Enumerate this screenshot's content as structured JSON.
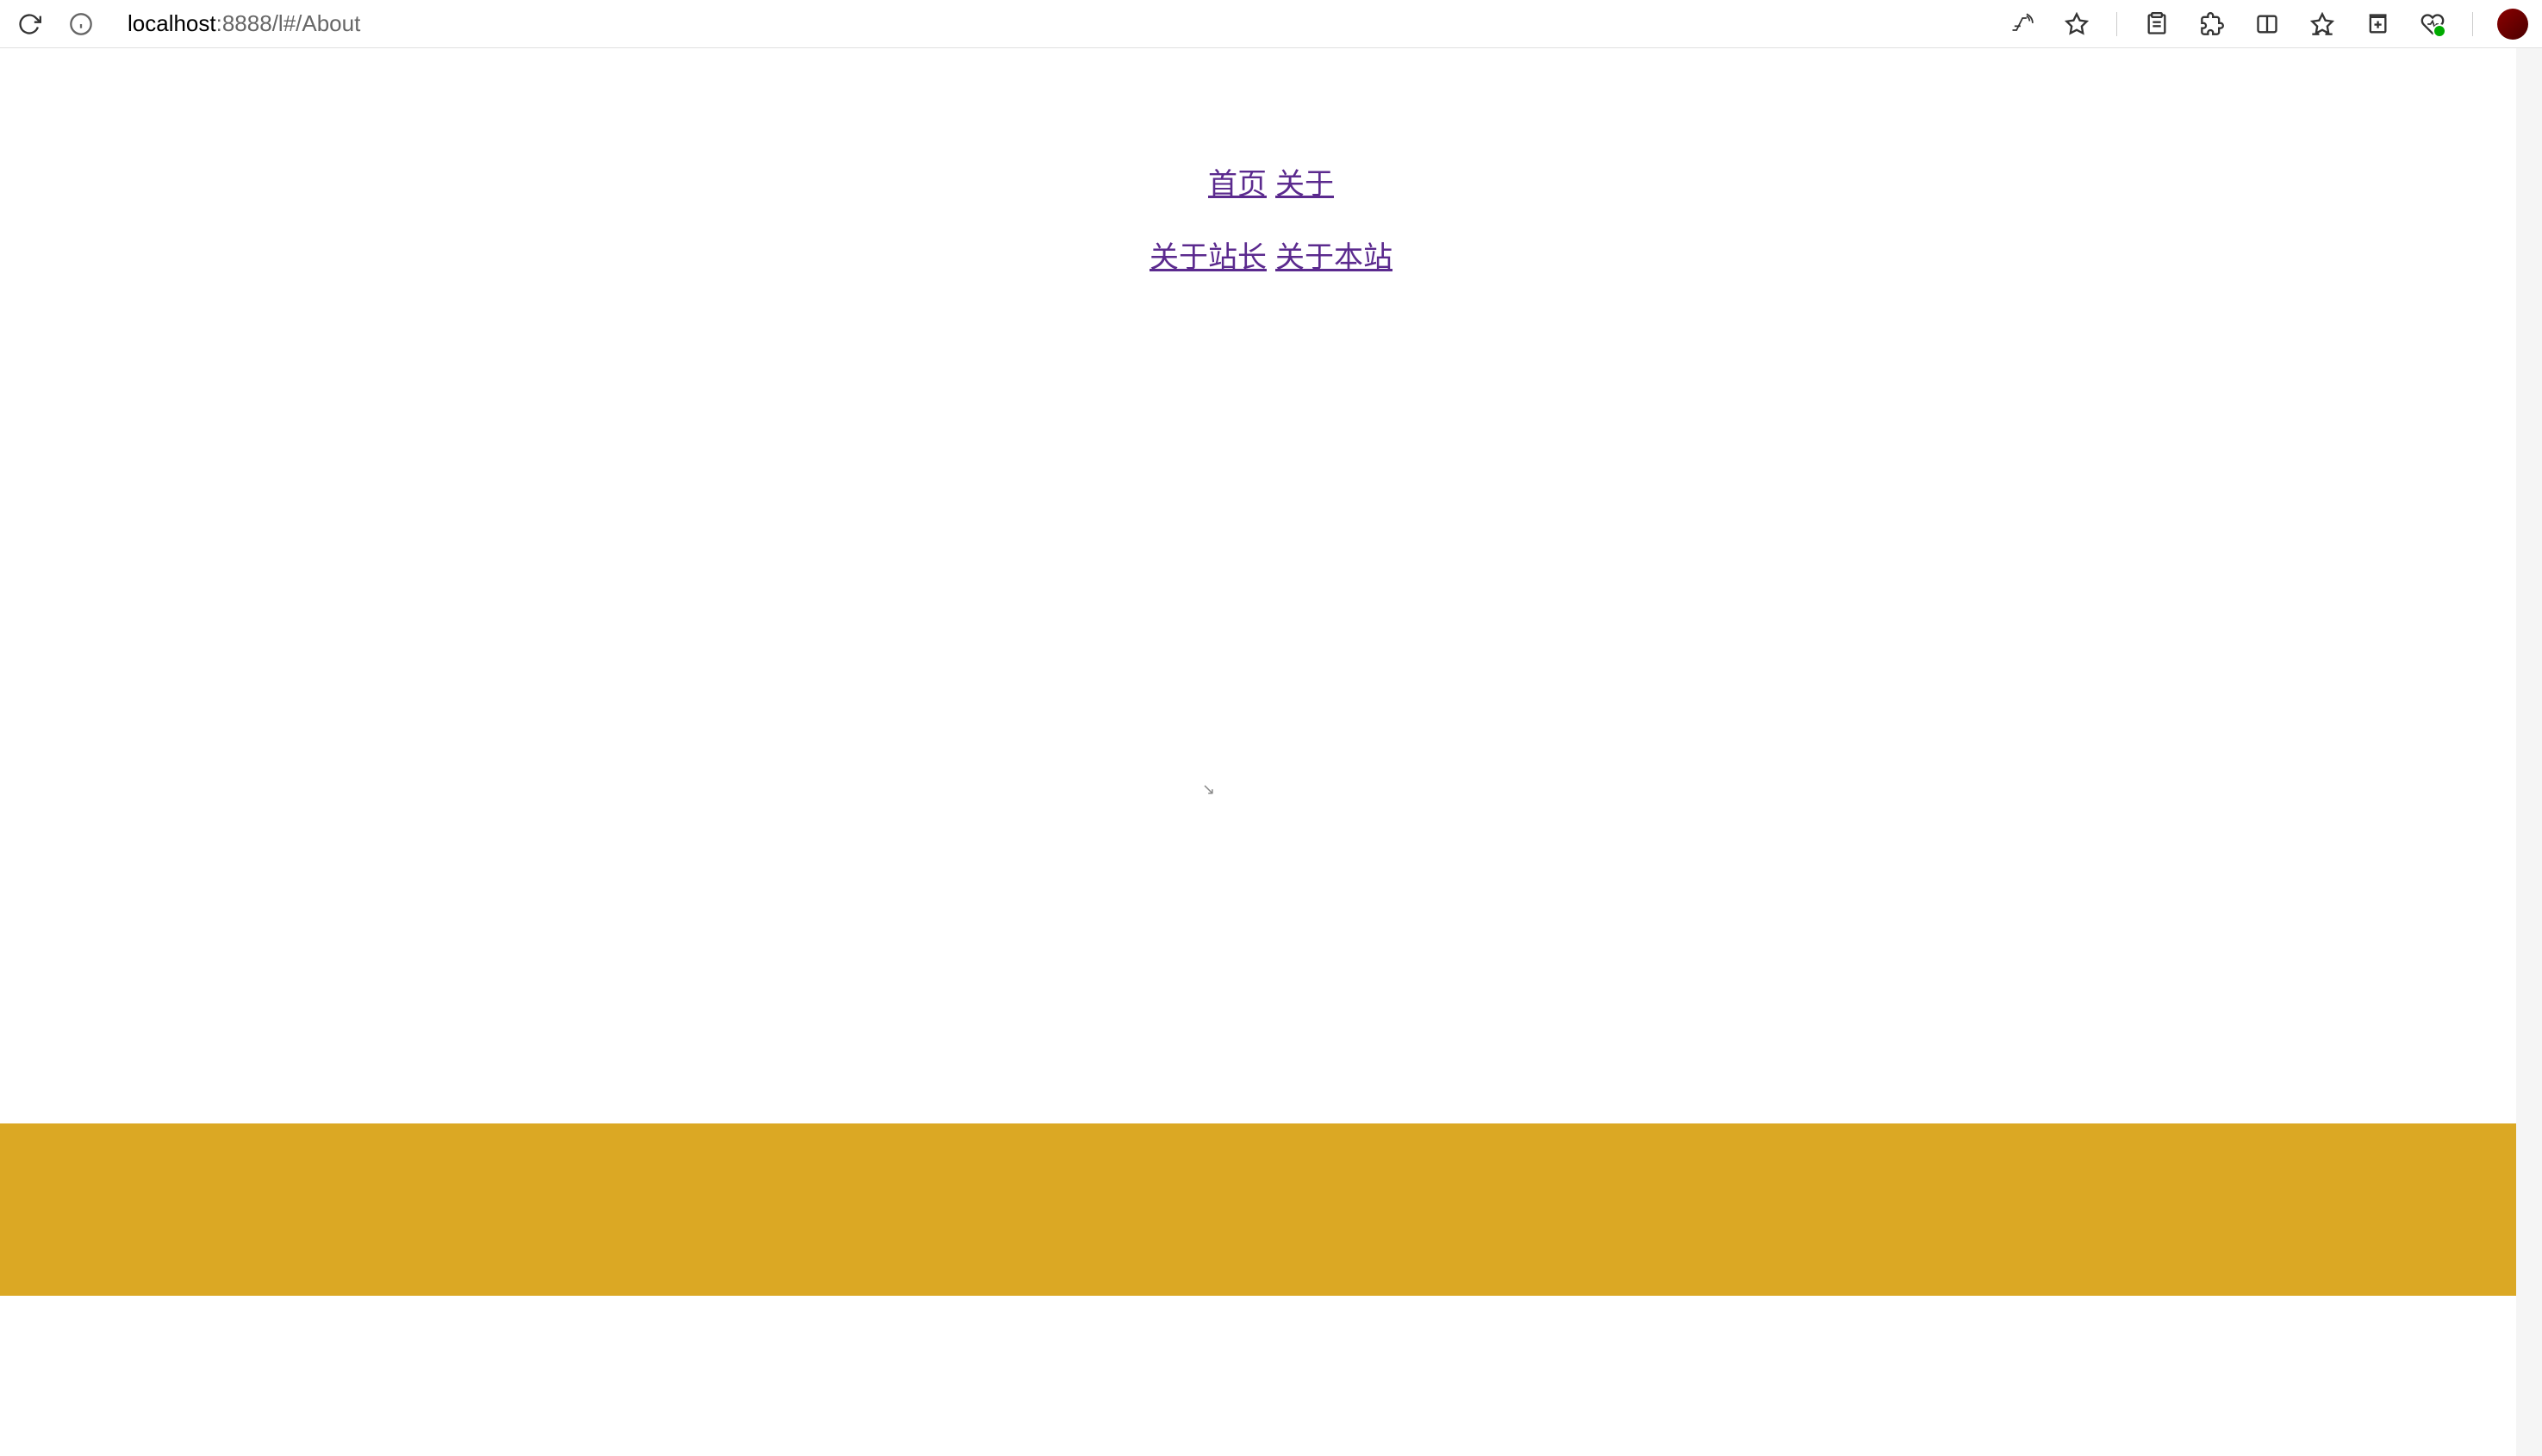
{
  "browser": {
    "url_host": "localhost",
    "url_rest": ":8888/l#/About"
  },
  "nav": {
    "row1": [
      {
        "label": "首页"
      },
      {
        "label": "关于"
      }
    ],
    "row2": [
      {
        "label": "关于站长"
      },
      {
        "label": "关于本站"
      }
    ]
  },
  "colors": {
    "link": "#5b2a8e",
    "gold_bar": "#dba824"
  }
}
